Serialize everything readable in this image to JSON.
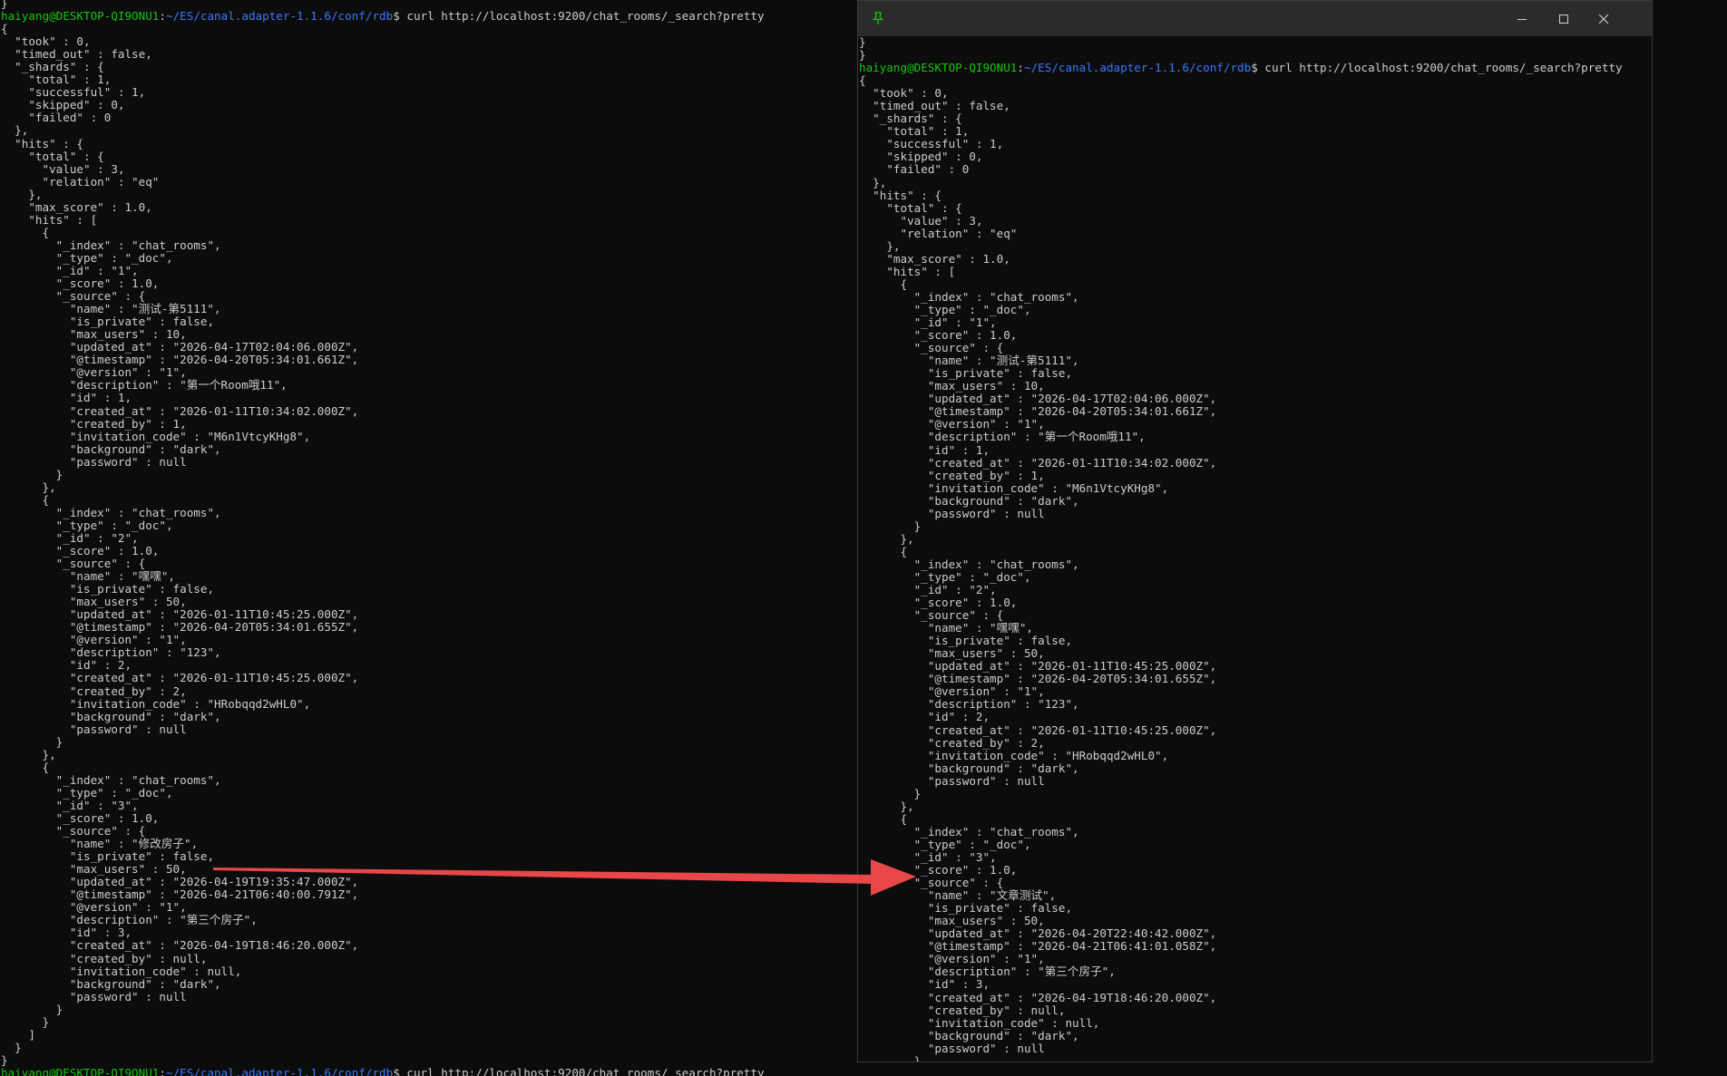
{
  "left_terminal": {
    "lines": [
      {
        "text": "}"
      },
      {
        "user": "haiyang@DESKTOP-QI9ONU1",
        "sep": ":",
        "path": "~/ES/canal.adapter-1.1.6/conf/rdb",
        "text": "$ curl http://localhost:9200/chat_rooms/_search?pretty"
      },
      {
        "text": "{"
      },
      {
        "text": "  \"took\" : 0,"
      },
      {
        "text": "  \"timed_out\" : false,"
      },
      {
        "text": "  \"_shards\" : {"
      },
      {
        "text": "    \"total\" : 1,"
      },
      {
        "text": "    \"successful\" : 1,"
      },
      {
        "text": "    \"skipped\" : 0,"
      },
      {
        "text": "    \"failed\" : 0"
      },
      {
        "text": "  },"
      },
      {
        "text": "  \"hits\" : {"
      },
      {
        "text": "    \"total\" : {"
      },
      {
        "text": "      \"value\" : 3,"
      },
      {
        "text": "      \"relation\" : \"eq\""
      },
      {
        "text": "    },"
      },
      {
        "text": "    \"max_score\" : 1.0,"
      },
      {
        "text": "    \"hits\" : ["
      },
      {
        "text": "      {"
      },
      {
        "text": "        \"_index\" : \"chat_rooms\","
      },
      {
        "text": "        \"_type\" : \"_doc\","
      },
      {
        "text": "        \"_id\" : \"1\","
      },
      {
        "text": "        \"_score\" : 1.0,"
      },
      {
        "text": "        \"_source\" : {"
      },
      {
        "text": "          \"name\" : \"测试-第5111\","
      },
      {
        "text": "          \"is_private\" : false,"
      },
      {
        "text": "          \"max_users\" : 10,"
      },
      {
        "text": "          \"updated_at\" : \"2026-04-17T02:04:06.000Z\","
      },
      {
        "text": "          \"@timestamp\" : \"2026-04-20T05:34:01.661Z\","
      },
      {
        "text": "          \"@version\" : \"1\","
      },
      {
        "text": "          \"description\" : \"第一个Room哦11\","
      },
      {
        "text": "          \"id\" : 1,"
      },
      {
        "text": "          \"created_at\" : \"2026-01-11T10:34:02.000Z\","
      },
      {
        "text": "          \"created_by\" : 1,"
      },
      {
        "text": "          \"invitation_code\" : \"M6n1VtcyKHg8\","
      },
      {
        "text": "          \"background\" : \"dark\","
      },
      {
        "text": "          \"password\" : null"
      },
      {
        "text": "        }"
      },
      {
        "text": "      },"
      },
      {
        "text": "      {"
      },
      {
        "text": "        \"_index\" : \"chat_rooms\","
      },
      {
        "text": "        \"_type\" : \"_doc\","
      },
      {
        "text": "        \"_id\" : \"2\","
      },
      {
        "text": "        \"_score\" : 1.0,"
      },
      {
        "text": "        \"_source\" : {"
      },
      {
        "text": "          \"name\" : \"嘿嘿\","
      },
      {
        "text": "          \"is_private\" : false,"
      },
      {
        "text": "          \"max_users\" : 50,"
      },
      {
        "text": "          \"updated_at\" : \"2026-01-11T10:45:25.000Z\","
      },
      {
        "text": "          \"@timestamp\" : \"2026-04-20T05:34:01.655Z\","
      },
      {
        "text": "          \"@version\" : \"1\","
      },
      {
        "text": "          \"description\" : \"123\","
      },
      {
        "text": "          \"id\" : 2,"
      },
      {
        "text": "          \"created_at\" : \"2026-01-11T10:45:25.000Z\","
      },
      {
        "text": "          \"created_by\" : 2,"
      },
      {
        "text": "          \"invitation_code\" : \"HRobqqd2wHL0\","
      },
      {
        "text": "          \"background\" : \"dark\","
      },
      {
        "text": "          \"password\" : null"
      },
      {
        "text": "        }"
      },
      {
        "text": "      },"
      },
      {
        "text": "      {"
      },
      {
        "text": "        \"_index\" : \"chat_rooms\","
      },
      {
        "text": "        \"_type\" : \"_doc\","
      },
      {
        "text": "        \"_id\" : \"3\","
      },
      {
        "text": "        \"_score\" : 1.0,"
      },
      {
        "text": "        \"_source\" : {"
      },
      {
        "text": "          \"name\" : \"修改房子\","
      },
      {
        "text": "          \"is_private\" : false,"
      },
      {
        "text": "          \"max_users\" : 50,"
      },
      {
        "text": "          \"updated_at\" : \"2026-04-19T19:35:47.000Z\","
      },
      {
        "text": "          \"@timestamp\" : \"2026-04-21T06:40:00.791Z\","
      },
      {
        "text": "          \"@version\" : \"1\","
      },
      {
        "text": "          \"description\" : \"第三个房子\","
      },
      {
        "text": "          \"id\" : 3,"
      },
      {
        "text": "          \"created_at\" : \"2026-04-19T18:46:20.000Z\","
      },
      {
        "text": "          \"created_by\" : null,"
      },
      {
        "text": "          \"invitation_code\" : null,"
      },
      {
        "text": "          \"background\" : \"dark\","
      },
      {
        "text": "          \"password\" : null"
      },
      {
        "text": "        }"
      },
      {
        "text": "      }"
      },
      {
        "text": "    ]"
      },
      {
        "text": "  }"
      },
      {
        "text": "}"
      },
      {
        "user": "haiyang@DESKTOP-QI9ONU1",
        "sep": ":",
        "path": "~/ES/canal.adapter-1.1.6/conf/rdb",
        "text": "$ curl http://localhost:9200/chat_rooms/_search?pretty"
      }
    ]
  },
  "right_window": {
    "titlebar": {
      "pin_icon": "pin-icon",
      "minimize_icon": "minimize-icon",
      "maximize_icon": "maximize-icon",
      "close_icon": "close-icon"
    },
    "lines": [
      {
        "text": "}"
      },
      {
        "text": "}"
      },
      {
        "user": "haiyang@DESKTOP-QI9ONU1",
        "sep": ":",
        "path": "~/ES/canal.adapter-1.1.6/conf/rdb",
        "text": "$ curl http://localhost:9200/chat_rooms/_search?pretty"
      },
      {
        "text": "{"
      },
      {
        "text": "  \"took\" : 0,"
      },
      {
        "text": "  \"timed_out\" : false,"
      },
      {
        "text": "  \"_shards\" : {"
      },
      {
        "text": "    \"total\" : 1,"
      },
      {
        "text": "    \"successful\" : 1,"
      },
      {
        "text": "    \"skipped\" : 0,"
      },
      {
        "text": "    \"failed\" : 0"
      },
      {
        "text": "  },"
      },
      {
        "text": "  \"hits\" : {"
      },
      {
        "text": "    \"total\" : {"
      },
      {
        "text": "      \"value\" : 3,"
      },
      {
        "text": "      \"relation\" : \"eq\""
      },
      {
        "text": "    },"
      },
      {
        "text": "    \"max_score\" : 1.0,"
      },
      {
        "text": "    \"hits\" : ["
      },
      {
        "text": "      {"
      },
      {
        "text": "        \"_index\" : \"chat_rooms\","
      },
      {
        "text": "        \"_type\" : \"_doc\","
      },
      {
        "text": "        \"_id\" : \"1\","
      },
      {
        "text": "        \"_score\" : 1.0,"
      },
      {
        "text": "        \"_source\" : {"
      },
      {
        "text": "          \"name\" : \"测试-第5111\","
      },
      {
        "text": "          \"is_private\" : false,"
      },
      {
        "text": "          \"max_users\" : 10,"
      },
      {
        "text": "          \"updated_at\" : \"2026-04-17T02:04:06.000Z\","
      },
      {
        "text": "          \"@timestamp\" : \"2026-04-20T05:34:01.661Z\","
      },
      {
        "text": "          \"@version\" : \"1\","
      },
      {
        "text": "          \"description\" : \"第一个Room哦11\","
      },
      {
        "text": "          \"id\" : 1,"
      },
      {
        "text": "          \"created_at\" : \"2026-01-11T10:34:02.000Z\","
      },
      {
        "text": "          \"created_by\" : 1,"
      },
      {
        "text": "          \"invitation_code\" : \"M6n1VtcyKHg8\","
      },
      {
        "text": "          \"background\" : \"dark\","
      },
      {
        "text": "          \"password\" : null"
      },
      {
        "text": "        }"
      },
      {
        "text": "      },"
      },
      {
        "text": "      {"
      },
      {
        "text": "        \"_index\" : \"chat_rooms\","
      },
      {
        "text": "        \"_type\" : \"_doc\","
      },
      {
        "text": "        \"_id\" : \"2\","
      },
      {
        "text": "        \"_score\" : 1.0,"
      },
      {
        "text": "        \"_source\" : {"
      },
      {
        "text": "          \"name\" : \"嘿嘿\","
      },
      {
        "text": "          \"is_private\" : false,"
      },
      {
        "text": "          \"max_users\" : 50,"
      },
      {
        "text": "          \"updated_at\" : \"2026-01-11T10:45:25.000Z\","
      },
      {
        "text": "          \"@timestamp\" : \"2026-04-20T05:34:01.655Z\","
      },
      {
        "text": "          \"@version\" : \"1\","
      },
      {
        "text": "          \"description\" : \"123\","
      },
      {
        "text": "          \"id\" : 2,"
      },
      {
        "text": "          \"created_at\" : \"2026-01-11T10:45:25.000Z\","
      },
      {
        "text": "          \"created_by\" : 2,"
      },
      {
        "text": "          \"invitation_code\" : \"HRobqqd2wHL0\","
      },
      {
        "text": "          \"background\" : \"dark\","
      },
      {
        "text": "          \"password\" : null"
      },
      {
        "text": "        }"
      },
      {
        "text": "      },"
      },
      {
        "text": "      {"
      },
      {
        "text": "        \"_index\" : \"chat_rooms\","
      },
      {
        "text": "        \"_type\" : \"_doc\","
      },
      {
        "text": "        \"_id\" : \"3\","
      },
      {
        "text": "        \"_score\" : 1.0,"
      },
      {
        "text": "        \"_source\" : {"
      },
      {
        "text": "          \"name\" : \"文章测试\","
      },
      {
        "text": "          \"is_private\" : false,"
      },
      {
        "text": "          \"max_users\" : 50,"
      },
      {
        "text": "          \"updated_at\" : \"2026-04-20T22:40:42.000Z\","
      },
      {
        "text": "          \"@timestamp\" : \"2026-04-21T06:41:01.058Z\","
      },
      {
        "text": "          \"@version\" : \"1\","
      },
      {
        "text": "          \"description\" : \"第三个房子\","
      },
      {
        "text": "          \"id\" : 3,"
      },
      {
        "text": "          \"created_at\" : \"2026-04-19T18:46:20.000Z\","
      },
      {
        "text": "          \"created_by\" : null,"
      },
      {
        "text": "          \"invitation_code\" : null,"
      },
      {
        "text": "          \"background\" : \"dark\","
      },
      {
        "text": "          \"password\" : null"
      },
      {
        "text": "        }"
      },
      {
        "text": "      }"
      }
    ]
  },
  "colors": {
    "background": "#0c0c0c",
    "text": "#cccccc",
    "prompt_user": "#16c60c",
    "prompt_path": "#3b78ff",
    "titlebar": "#2b2b2b",
    "arrow": "#e8474a"
  }
}
